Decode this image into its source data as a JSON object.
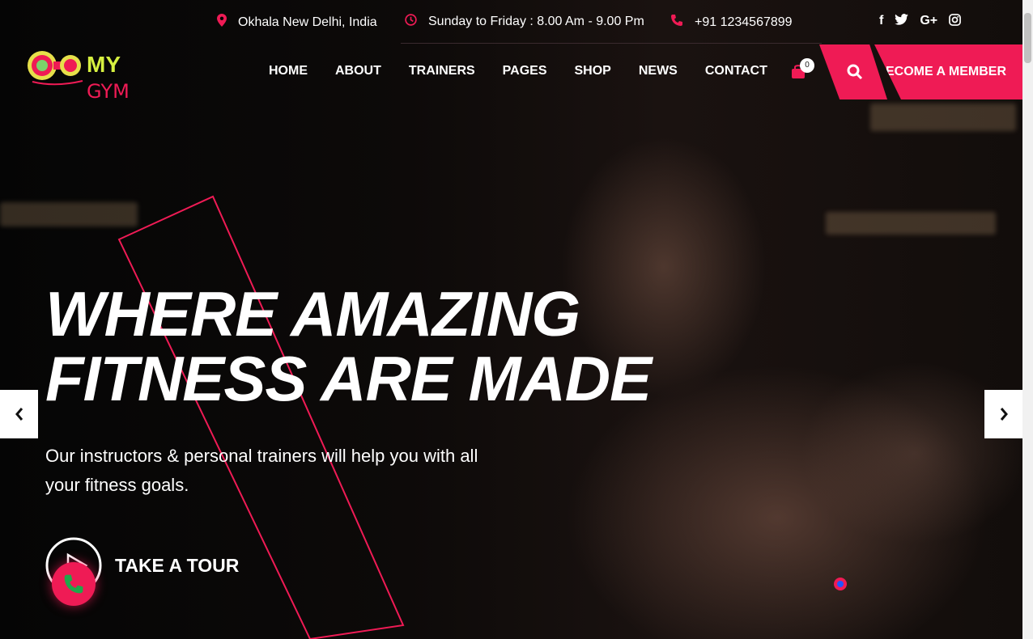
{
  "topbar": {
    "location": "Okhala New Delhi, India",
    "hours": "Sunday to Friday : 8.00 Am - 9.00 Pm",
    "phone": "+91 1234567899",
    "social": [
      "f",
      "twitter",
      "G+",
      "instagram"
    ]
  },
  "logo": {
    "my": "MY",
    "gym": "GYM"
  },
  "nav": [
    "HOME",
    "ABOUT",
    "TRAINERS",
    "PAGES",
    "SHOP",
    "NEWS",
    "CONTACT"
  ],
  "cart": {
    "count": "0"
  },
  "cta": {
    "member_label": "BECOME A MEMBER"
  },
  "hero": {
    "headline_line1": "WHERE AMAZING",
    "headline_line2": "FITNESS ARE MADE",
    "subtext": "Our instructors & personal trainers will help you with all your fitness goals.",
    "tour_label": "TAKE A TOUR"
  },
  "colors": {
    "accent": "#ef1b55",
    "logo_yellow": "#d6f040",
    "background": "#000000"
  },
  "icons": [
    "map-pin-icon",
    "clock-icon",
    "phone-icon",
    "cart-icon",
    "search-icon",
    "chevron-left-icon",
    "chevron-right-icon",
    "play-icon"
  ]
}
